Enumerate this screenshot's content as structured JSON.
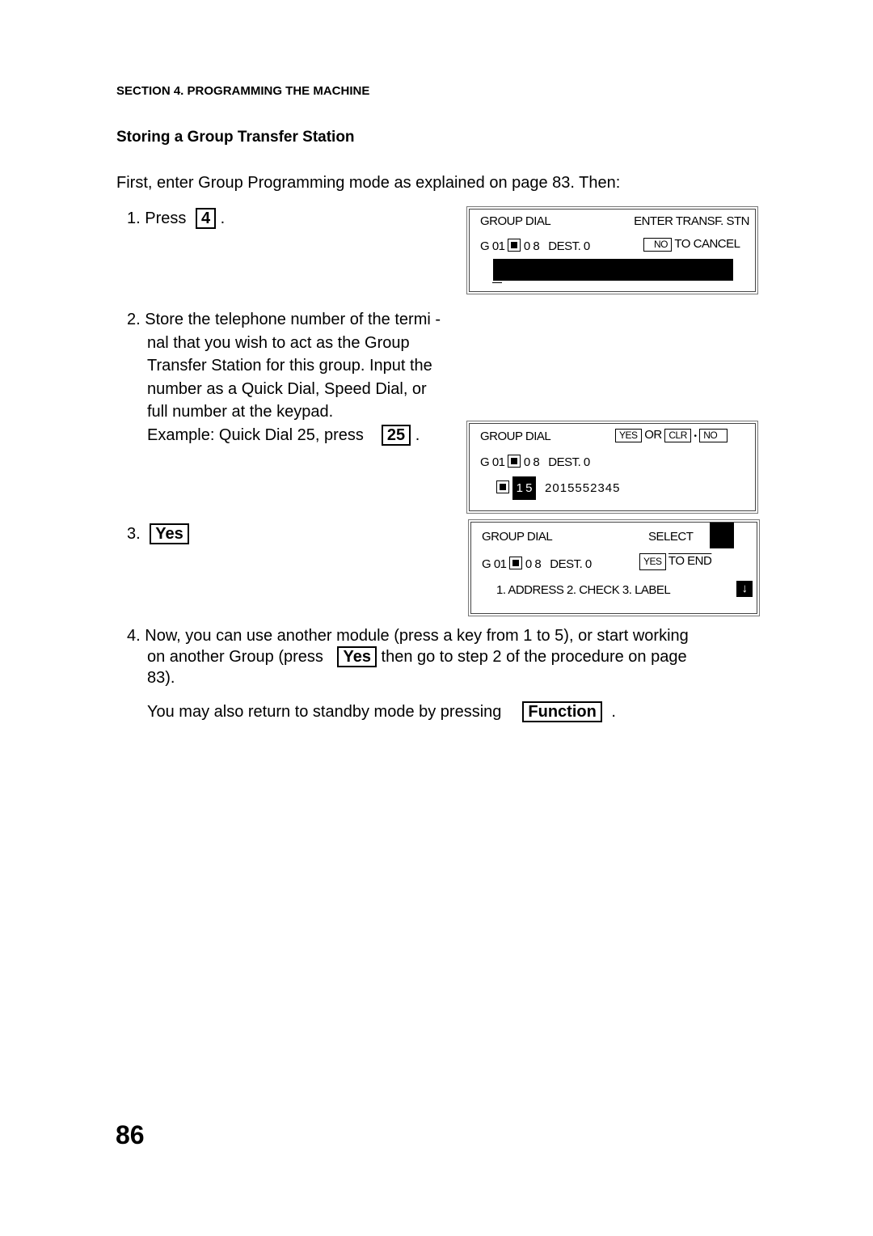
{
  "header": {
    "section": "SECTION 4. PROGRAMMING THE MACHINE"
  },
  "title": "Storing a Group Transfer Station",
  "intro": "First, enter Group Programming mode as explained on page   83. Then:",
  "step1": {
    "num": "1.",
    "text": "Press",
    "key": "4",
    "end": "."
  },
  "step2": {
    "num": "2.",
    "lines": [
      "Store the telephone number of the termi -",
      "nal that you wish to act as the Group",
      "Transfer Station for this group. Input the",
      "number as a Quick Dial, Speed Dial, or",
      "full number at the keypad."
    ],
    "example": "Example: Quick Dial 25, press",
    "key": "25",
    "end": "."
  },
  "step3": {
    "num": "3.",
    "key": "Yes"
  },
  "step4": {
    "num": "4.",
    "line1": "Now, you can use another module (press a key from 1 to 5), or start working",
    "line2a": "on another Group (press",
    "key": "Yes",
    "line2b": "then go to step 2 of the procedure on page",
    "line3": "83).",
    "standby": "You may also return to standby mode by pressing",
    "function_key": "Function",
    "end": "."
  },
  "lcd1": {
    "title": "GROUP DIAL",
    "prompt": "ENTER TRANSF. STN",
    "group": "G 01",
    "num": "0 8",
    "dest": "DEST. 0",
    "no": "NO",
    "cancel": "TO CANCEL"
  },
  "lcd2": {
    "title": "GROUP DIAL",
    "yes": "YES",
    "or": "OR",
    "clr": "CLR",
    "dot": "•",
    "no": "NO",
    "group": "G 01",
    "num": "0 8",
    "dest": "DEST. 0",
    "quick": "1 5",
    "phone": "2015552345"
  },
  "lcd3": {
    "title": "GROUP DIAL",
    "select": "SELECT",
    "group": "G 01",
    "num": "0 8",
    "dest": "DEST. 0",
    "yes": "YES",
    "end": "TO END",
    "menu": "1. ADDRESS  2. CHECK  3. LABEL"
  },
  "page_number": "86"
}
